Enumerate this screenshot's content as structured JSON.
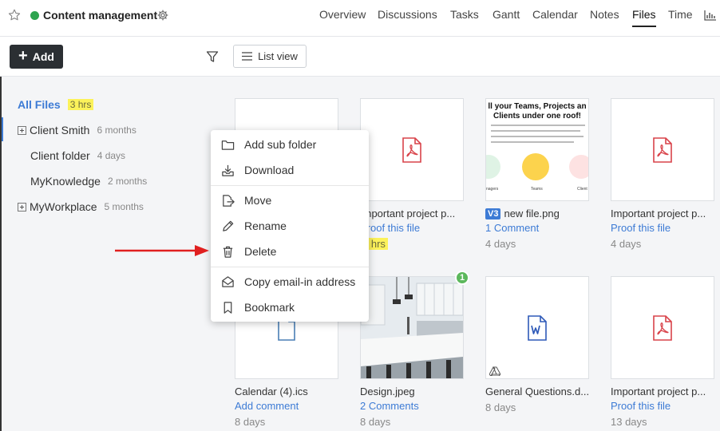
{
  "header": {
    "project_title": "Content management",
    "status_color": "#2ea44f",
    "tabs": [
      {
        "label": "Overview"
      },
      {
        "label": "Discussions"
      },
      {
        "label": "Tasks"
      },
      {
        "label": "Gantt"
      },
      {
        "label": "Calendar"
      },
      {
        "label": "Notes"
      },
      {
        "label": "Files",
        "active": true
      },
      {
        "label": "Time"
      }
    ],
    "icons": [
      "star-icon",
      "gear-icon",
      "reports-icon"
    ]
  },
  "toolbar": {
    "add_label": "Add",
    "view_label": "List view",
    "icons": [
      "plus-icon",
      "filter-icon",
      "list-icon"
    ]
  },
  "sidebar": {
    "all_files": {
      "label": "All Files",
      "time": "3 hrs"
    },
    "items": [
      {
        "label": "Client Smith",
        "meta": "6 months",
        "expandable": true
      },
      {
        "label": "Client folder",
        "meta": "4 days",
        "expandable": false
      },
      {
        "label": "MyKnowledge",
        "meta": "2 months",
        "expandable": false
      },
      {
        "label": "MyWorkplace",
        "meta": "5 months",
        "expandable": true
      }
    ]
  },
  "files": [
    {
      "name": "",
      "link": "",
      "age": ""
    },
    {
      "name": "Important project p...",
      "link": "Proof this file",
      "age": "3 hrs",
      "type": "pdf"
    },
    {
      "name": "new file.png",
      "version": "V3",
      "link": "1 Comment",
      "age": "4 days",
      "type": "image"
    },
    {
      "name": "Important project p...",
      "link": "Proof this file",
      "age": "4 days",
      "type": "pdf"
    },
    {
      "name": "Calendar (4).ics",
      "link": "Add comment",
      "age": "8 days",
      "type": "file"
    },
    {
      "name": "Design.jpeg",
      "link": "2 Comments",
      "age": "8 days",
      "type": "image",
      "badge": "1"
    },
    {
      "name": "General Questions.d...",
      "link": "",
      "age": "8 days",
      "type": "word"
    },
    {
      "name": "Important project p...",
      "link": "Proof this file",
      "age": "13 days",
      "type": "pdf"
    }
  ],
  "promo_image": {
    "headline": "ll your Teams, Projects an Clients under one roof!",
    "caption_left": "nagers",
    "caption_mid": "Teams",
    "caption_right": "Client"
  },
  "context_menu": {
    "items": [
      {
        "label": "Add sub folder",
        "icon": "folder-icon"
      },
      {
        "label": "Download",
        "icon": "download-icon"
      },
      {
        "label": "Move",
        "icon": "move-icon"
      },
      {
        "label": "Rename",
        "icon": "pencil-icon"
      },
      {
        "label": "Delete",
        "icon": "trash-icon"
      },
      {
        "label": "Copy email-in address",
        "icon": "envelope-icon"
      },
      {
        "label": "Bookmark",
        "icon": "bookmark-icon"
      }
    ]
  },
  "colors": {
    "accent": "#3d7bd5",
    "highlight": "#fcf25a",
    "pdf": "#d9434a",
    "word": "#2f5ab8",
    "arrow": "#e02020"
  }
}
